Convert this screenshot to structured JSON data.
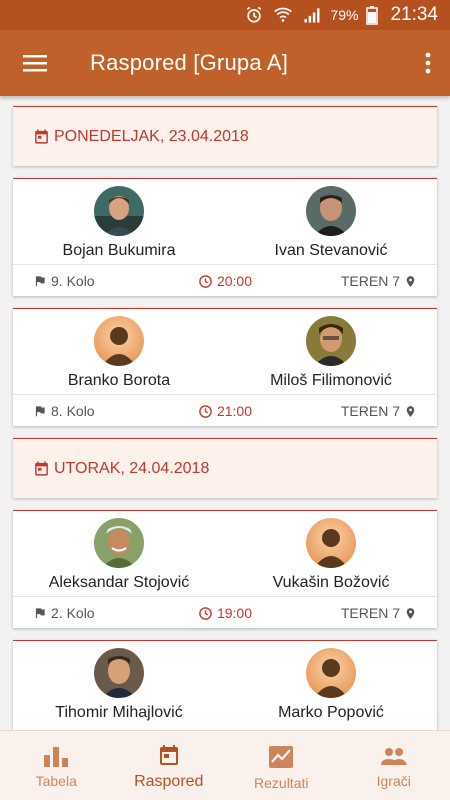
{
  "status": {
    "battery": "79%",
    "time": "21:34"
  },
  "appbar": {
    "title": "Raspored [Grupa A]"
  },
  "schedule": [
    {
      "date": "PONEDELJAK, 23.04.2018",
      "matches": [
        {
          "home": "Bojan Bukumira",
          "away": "Ivan Stevanović",
          "round": "9. Kolo",
          "time": "20:00",
          "court": "TEREN 7",
          "home_avatar": "photo",
          "away_avatar": "photo"
        },
        {
          "home": "Branko Borota",
          "away": "Miloš Filimonović",
          "round": "8. Kolo",
          "time": "21:00",
          "court": "TEREN 7",
          "home_avatar": "placeholder",
          "away_avatar": "photo"
        }
      ]
    },
    {
      "date": "UTORAK, 24.04.2018",
      "matches": [
        {
          "home": "Aleksandar Stojović",
          "away": "Vukašin Božović",
          "round": "2. Kolo",
          "time": "19:00",
          "court": "TEREN 7",
          "home_avatar": "photo",
          "away_avatar": "placeholder"
        },
        {
          "home": "Tihomir Mihajlović",
          "away": "Marko Popović",
          "round": "",
          "time": "",
          "court": "",
          "home_avatar": "photo",
          "away_avatar": "placeholder"
        }
      ]
    }
  ],
  "nav": [
    {
      "label": "Tabela",
      "icon": "bar-chart-icon",
      "active": false
    },
    {
      "label": "Raspored",
      "icon": "calendar-icon",
      "active": true
    },
    {
      "label": "Rezultati",
      "icon": "trend-chart-icon",
      "active": false
    },
    {
      "label": "Igrači",
      "icon": "people-icon",
      "active": false
    }
  ],
  "colors": {
    "primary": "#c0602b",
    "primary_dark": "#b5511f",
    "accent": "#c0392b",
    "date_bg": "#fdf1ec"
  }
}
